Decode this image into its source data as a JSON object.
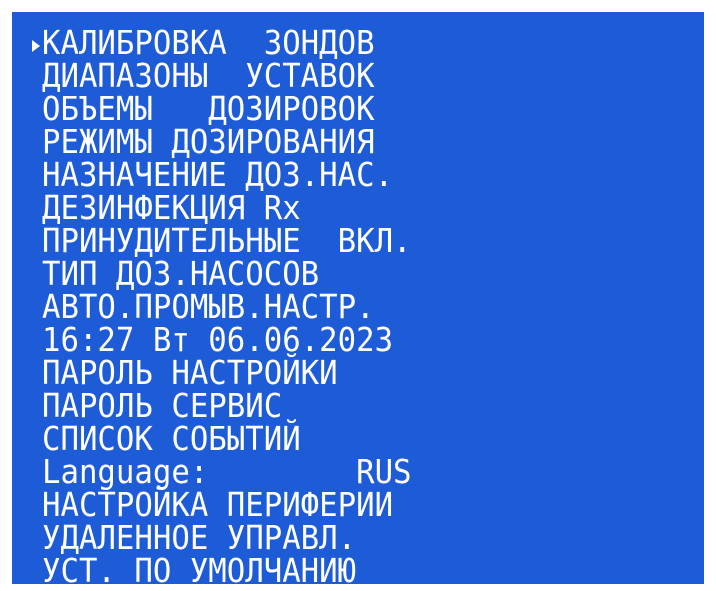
{
  "menu": {
    "items": [
      {
        "label": "КАЛИБРОВКА  ЗОНДОВ"
      },
      {
        "label": "ДИАПАЗОНЫ  УСТАВОК"
      },
      {
        "label": "ОБЪЕМЫ   ДОЗИРОВОК"
      },
      {
        "label": "РЕЖИМЫ ДОЗИРОВАНИЯ"
      },
      {
        "label": "НАЗНАЧЕНИЕ ДОЗ.НАС."
      },
      {
        "label": "ДЕЗИНФЕКЦИЯ Rx"
      },
      {
        "label": "ПРИНУДИТЕЛЬНЫЕ  ВКЛ."
      },
      {
        "label": "ТИП ДОЗ.НАСОСОВ"
      },
      {
        "label": "АВТО.ПРОМЫВ.НАСТР."
      },
      {
        "label": "16:27 Вт 06.06.2023"
      },
      {
        "label": "ПАРОЛЬ НАСТРОЙКИ"
      },
      {
        "label": "ПАРОЛЬ СЕРВИС"
      },
      {
        "label": "СПИСОК СОБЫТИЙ"
      },
      {
        "label": "Language:        RUS"
      },
      {
        "label": "НАСТРОЙКА ПЕРИФЕРИИ"
      },
      {
        "label": "УДАЛЕННОЕ УПРАВЛ."
      },
      {
        "label": "УСТ. ПО УМОЛЧАНИЮ"
      }
    ]
  },
  "colors": {
    "screen_background": "#1d5cd6",
    "text": "#ffffff"
  },
  "icons": {
    "cursor": "triangle-right-icon"
  }
}
